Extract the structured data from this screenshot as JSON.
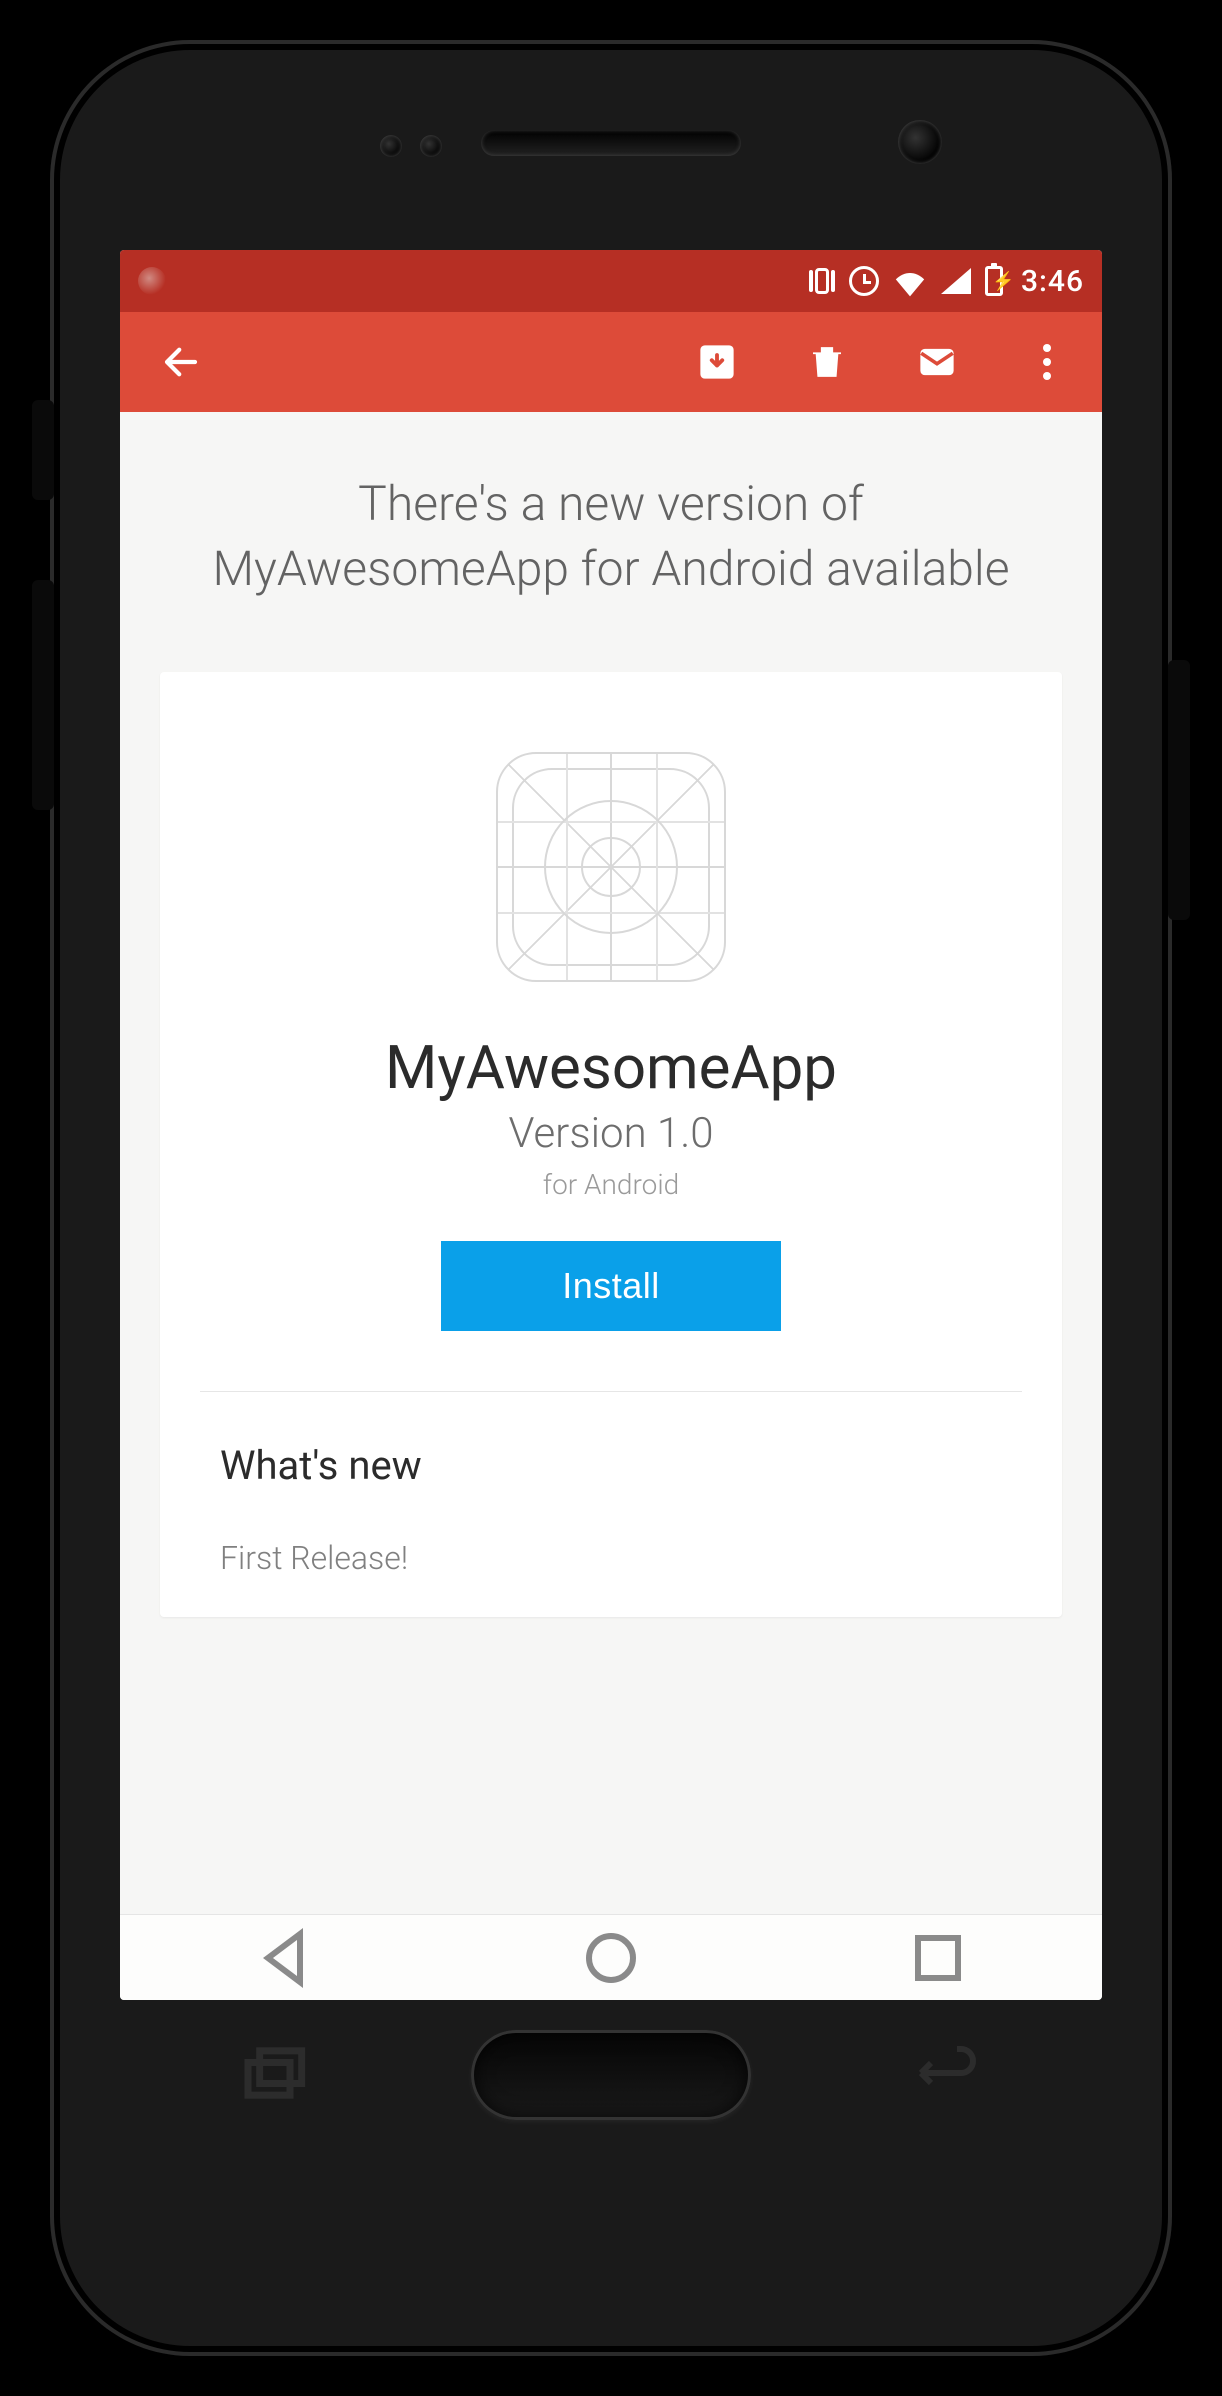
{
  "colors": {
    "status_bar": "#b62f24",
    "app_bar": "#dd4b39",
    "accent": "#0aa0e9"
  },
  "status": {
    "time": "3:46"
  },
  "email": {
    "subject": "There's a new version of MyAwesomeApp for Android available"
  },
  "app": {
    "name": "MyAwesomeApp",
    "version_label": "Version 1.0",
    "platform_label": "for Android",
    "install_button": "Install"
  },
  "whats_new": {
    "title": "What's new",
    "notes": "First Release!"
  }
}
